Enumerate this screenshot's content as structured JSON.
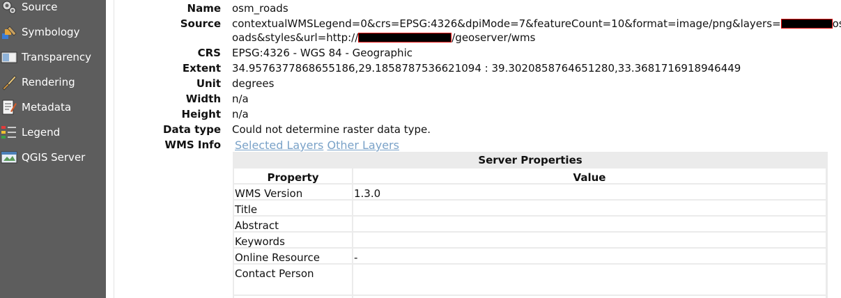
{
  "sidebar": {
    "items": [
      {
        "label": "Source",
        "icon": "source-icon"
      },
      {
        "label": "Symbology",
        "icon": "symbology-icon"
      },
      {
        "label": "Transparency",
        "icon": "transparency-icon"
      },
      {
        "label": "Rendering",
        "icon": "rendering-icon"
      },
      {
        "label": "Metadata",
        "icon": "metadata-icon"
      },
      {
        "label": "Legend",
        "icon": "legend-icon"
      },
      {
        "label": "QGIS Server",
        "icon": "qgis-server-icon"
      }
    ]
  },
  "info": {
    "name_label": "Name",
    "name_value": "osm_roads",
    "source_label": "Source",
    "source_line1_a": "contextualWMSLegend=0&crs=EPSG:4326&dpiMode=7&featureCount=10&format=image/png&layers=",
    "source_line1_b": "osm_r",
    "source_line2_a": "oads&styles&url=http://",
    "source_line2_b": "/geoserver/wms",
    "crs_label": "CRS",
    "crs_value": "EPSG:4326 - WGS 84 - Geographic",
    "extent_label": "Extent",
    "extent_value": "34.9576377868655186,29.1858787536621094 : 39.3020858764651280,33.3681716918946449",
    "unit_label": "Unit",
    "unit_value": "degrees",
    "width_label": "Width",
    "width_value": "n/a",
    "height_label": "Height",
    "height_value": "n/a",
    "datatype_label": "Data type",
    "datatype_value": "Could not determine raster data type.",
    "wmsinfo_label": "WMS Info",
    "link_selected": "Selected Layers",
    "link_other": "Other Layers"
  },
  "server": {
    "title": "Server Properties",
    "col_property": "Property",
    "col_value": "Value",
    "rows": [
      {
        "property": "WMS Version",
        "value": "1.3.0"
      },
      {
        "property": "Title",
        "value": ""
      },
      {
        "property": "Abstract",
        "value": ""
      },
      {
        "property": "Keywords",
        "value": ""
      },
      {
        "property": "Online Resource",
        "value": "-"
      },
      {
        "property": "Contact Person",
        "value": ""
      }
    ]
  },
  "colors": {
    "sidebar_bg": "#5d5d5d",
    "link": "#7aa2c8",
    "redaction": "#e00000"
  }
}
